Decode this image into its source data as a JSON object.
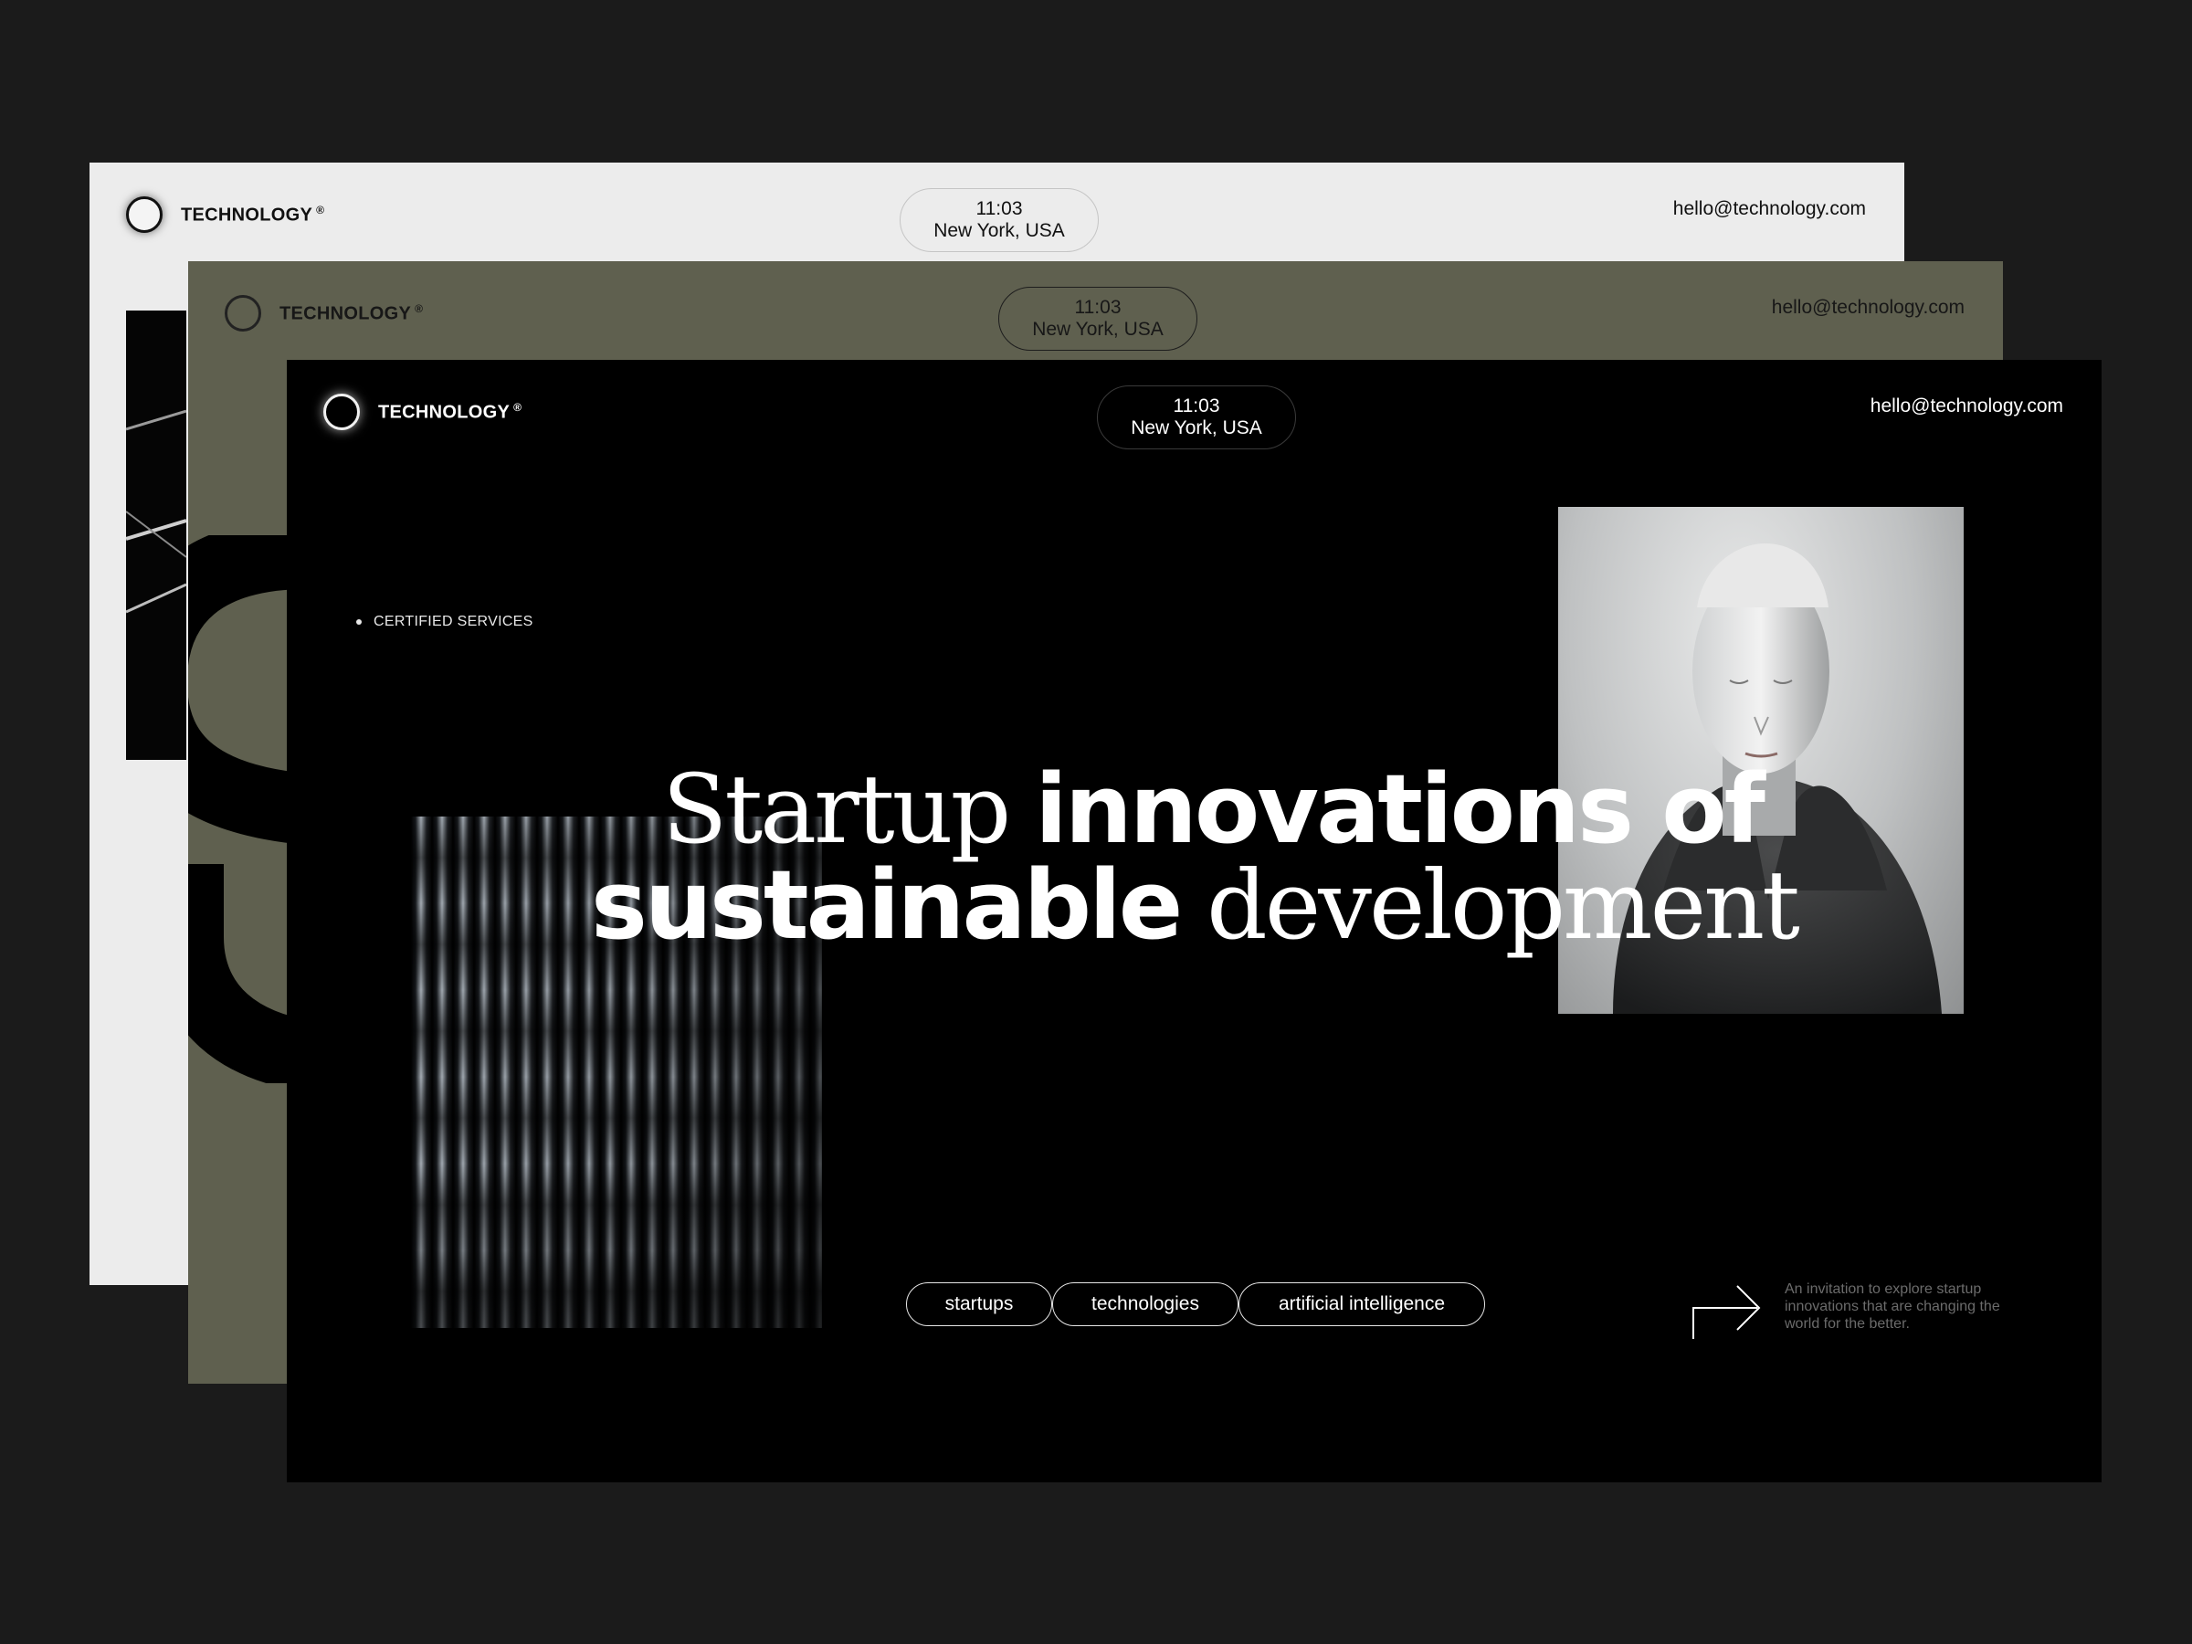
{
  "brand": {
    "name": "TECHNOLOGY",
    "mark": "®"
  },
  "clock": {
    "time": "11:03",
    "location": "New York, USA"
  },
  "contact": {
    "email": "hello@technology.com"
  },
  "hero": {
    "label": "CERTIFIED SERVICES",
    "line1_serif": "Startup",
    "line1_sans": "innovations of",
    "line2_sans": "sustainable",
    "line2_serif": "development"
  },
  "tags": [
    "startups",
    "technologies",
    "artificial intelligence"
  ],
  "invite_text": "An invitation to explore startup innovations that are changing the world for the better.",
  "colors": {
    "background": "#1b1b1b",
    "card_light": "#ececec",
    "card_olive": "#5f604f",
    "card_black": "#000000"
  },
  "icons": [
    "logo-ring-icon",
    "arrow-right-icon"
  ]
}
